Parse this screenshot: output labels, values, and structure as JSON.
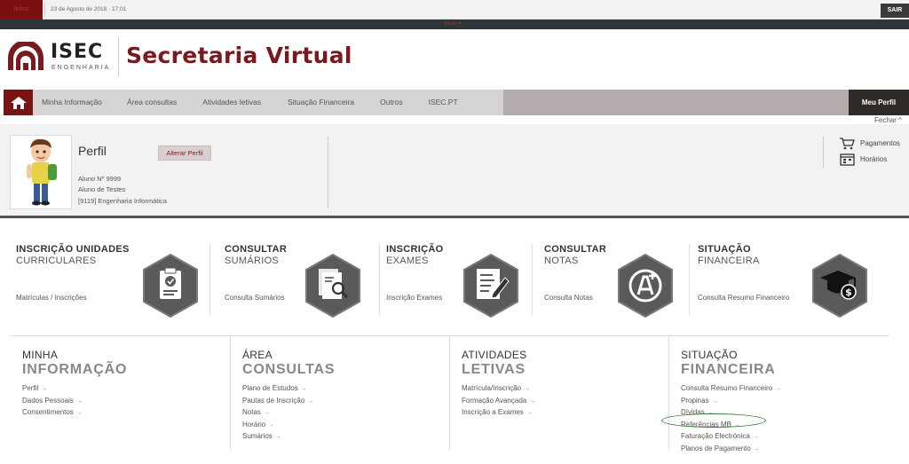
{
  "topbar": {
    "red_label": "Início",
    "date": "23 de Agosto de 2018 · 17:01",
    "logout": "SAIR"
  },
  "darkstrip": {
    "label": "Início ▾"
  },
  "header": {
    "logo_text": "ISEC",
    "logo_sub": "ENGENHARIA",
    "title": "Secretaria Virtual"
  },
  "nav": {
    "items": [
      "Minha Informação",
      "Área consultas",
      "Atividades letivas",
      "Situação Financeira",
      "Outros",
      "ISEC.PT"
    ],
    "profile_menu": "Meu Perfil"
  },
  "fechar": "Fechar ^",
  "profile": {
    "title": "Perfil",
    "change_button": "Alterar Perfil",
    "student_number": "Aluno Nº 9999",
    "student_name": "Aluno de Testes",
    "course": "[9119] Engenharia Informática",
    "quick_links": [
      {
        "label": "Pagamentos",
        "icon": "cart-icon"
      },
      {
        "label": "Horários",
        "icon": "calendar-icon"
      }
    ]
  },
  "tiles": [
    {
      "title1": "INSCRIÇÃO UNIDADES",
      "title2": "CURRICULARES",
      "link": "Matrículas / Inscrições",
      "icon": "clipboard-check-icon"
    },
    {
      "title1": "CONSULTAR",
      "title2": "SUMÁRIOS",
      "link": "Consulta Sumários",
      "icon": "document-search-icon"
    },
    {
      "title1": "INSCRIÇÃO",
      "title2": "EXAMES",
      "link": "Inscrição Exames",
      "icon": "exam-pencil-icon"
    },
    {
      "title1": "CONSULTAR",
      "title2": "NOTAS",
      "link": "Consulta Notas",
      "icon": "grade-a-plus-icon"
    },
    {
      "title1": "SITUAÇÃO",
      "title2": "FINANCEIRA",
      "link": "Consulta Resumo Financeiro",
      "icon": "graduate-money-icon"
    }
  ],
  "sitemap": [
    {
      "head1": "MINHA",
      "head2": "INFORMAÇÃO",
      "links": [
        "Perfil",
        "Dados Pessoais",
        "Consentimentos"
      ]
    },
    {
      "head1": "ÁREA",
      "head2": "CONSULTAS",
      "links": [
        "Plano de Estudos",
        "Pautas de Inscrição",
        "Notas",
        "Horário",
        "Sumários"
      ]
    },
    {
      "head1": "ATIVIDADES",
      "head2": "LETIVAS",
      "links": [
        "Matrícula/Inscrição",
        "Formação Avançada",
        "Inscrição a Exames"
      ]
    },
    {
      "head1": "SITUAÇÃO",
      "head2": "FINANCEIRA",
      "links": [
        "Consulta Resumo Financeiro",
        "Propinas",
        "Dívidas",
        "Referências MB",
        "Faturação Electrónica",
        "Planos de Pagamento"
      ]
    }
  ],
  "colors": {
    "brand": "#7a1a1e",
    "nav_bg": "#d5d3d3",
    "dark": "#2e3539",
    "highlight": "#2e7d32"
  }
}
